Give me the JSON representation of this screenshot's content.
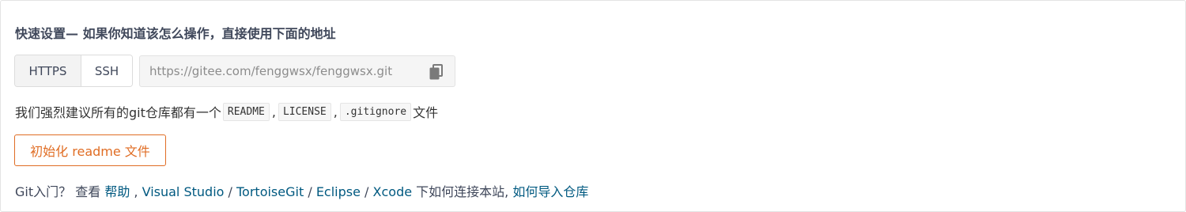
{
  "quick_setup": {
    "title": "快速设置— 如果你知道该怎么操作，直接使用下面的地址",
    "protocols": [
      {
        "label": "HTTPS",
        "active": true
      },
      {
        "label": "SSH",
        "active": false
      }
    ],
    "repo_url": "https://gitee.com/fenggwsx/fenggwsx.git",
    "copy_icon": "copy-icon"
  },
  "suggestion": {
    "prefix": "我们强烈建议所有的git仓库都有一个",
    "files": [
      "README",
      "LICENSE",
      ".gitignore"
    ],
    "separator": ",",
    "suffix": "文件"
  },
  "init_button": {
    "label": "初始化 readme 文件"
  },
  "help": {
    "prefix": "Git入门？ 查看",
    "help_link": "帮助",
    "comma": ",",
    "tools": [
      "Visual Studio",
      "TortoiseGit",
      "Eclipse",
      "Xcode"
    ],
    "slash": "/",
    "connect_text": "下如何连接本站,",
    "import_link": "如何导入仓库"
  },
  "colors": {
    "accent_orange": "#e06d24",
    "link_blue": "#005980"
  }
}
